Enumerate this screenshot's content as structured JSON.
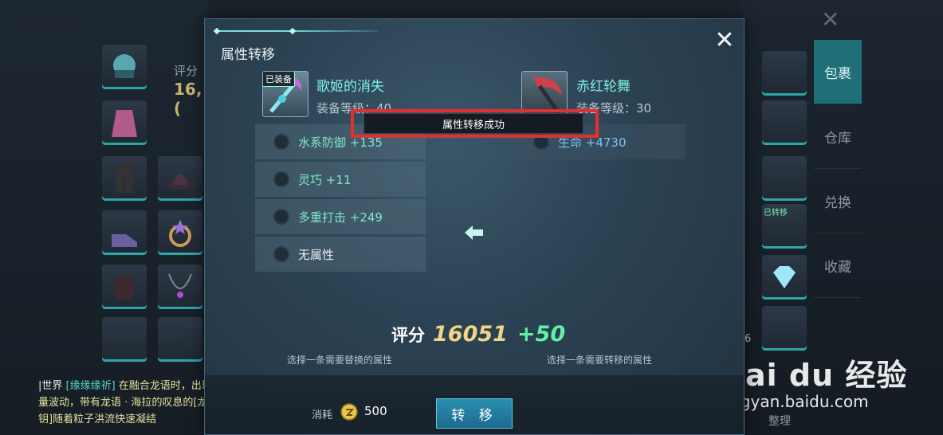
{
  "background": {
    "score_label": "评分",
    "score_value": "16,(",
    "side_tabs": [
      "包裹",
      "仓库",
      "兑换",
      "收藏"
    ],
    "active_tab": "包裹",
    "close_symbol": "✕",
    "arrange_label": "整理",
    "item_count": "6",
    "transfer_tag": "已转移"
  },
  "chat": {
    "channel": "|世界",
    "user": "[缘缘缘祈]",
    "message": "在融合龙语时，出现了强大的能量波动，带有龙语 · 海拉的叹息的[龙语 · 冥界之钥]随着粒子洪流快速凝结"
  },
  "watermark": {
    "logo": "Bai du 经验",
    "url": "jingyan.baidu.com"
  },
  "dialog": {
    "title": "属性转移",
    "close_symbol": "✕",
    "left_item": {
      "tag": "已装备",
      "name": "歌姬的消失",
      "level": "装备等级：40",
      "attributes": [
        "水系防御 +135",
        "灵巧 +11",
        "多重打击 +249",
        "无属性"
      ]
    },
    "right_item": {
      "name": "赤红轮舞",
      "level": "装备等级：30",
      "attributes": [
        "生命 +4730"
      ]
    },
    "toast": "属性转移成功",
    "score": {
      "label": "评分",
      "value": "16051",
      "delta": "+50"
    },
    "hint_left": "选择一条需要替换的属性",
    "hint_right": "选择一条需要转移的属性",
    "cost": {
      "label": "消耗",
      "value": "500"
    },
    "transfer_button": "转 移"
  },
  "colors": {
    "accent_teal": "#7ff0e2",
    "score_gold": "#f0d588",
    "score_green": "#5ff2a4",
    "highlight_red": "#e03030"
  }
}
